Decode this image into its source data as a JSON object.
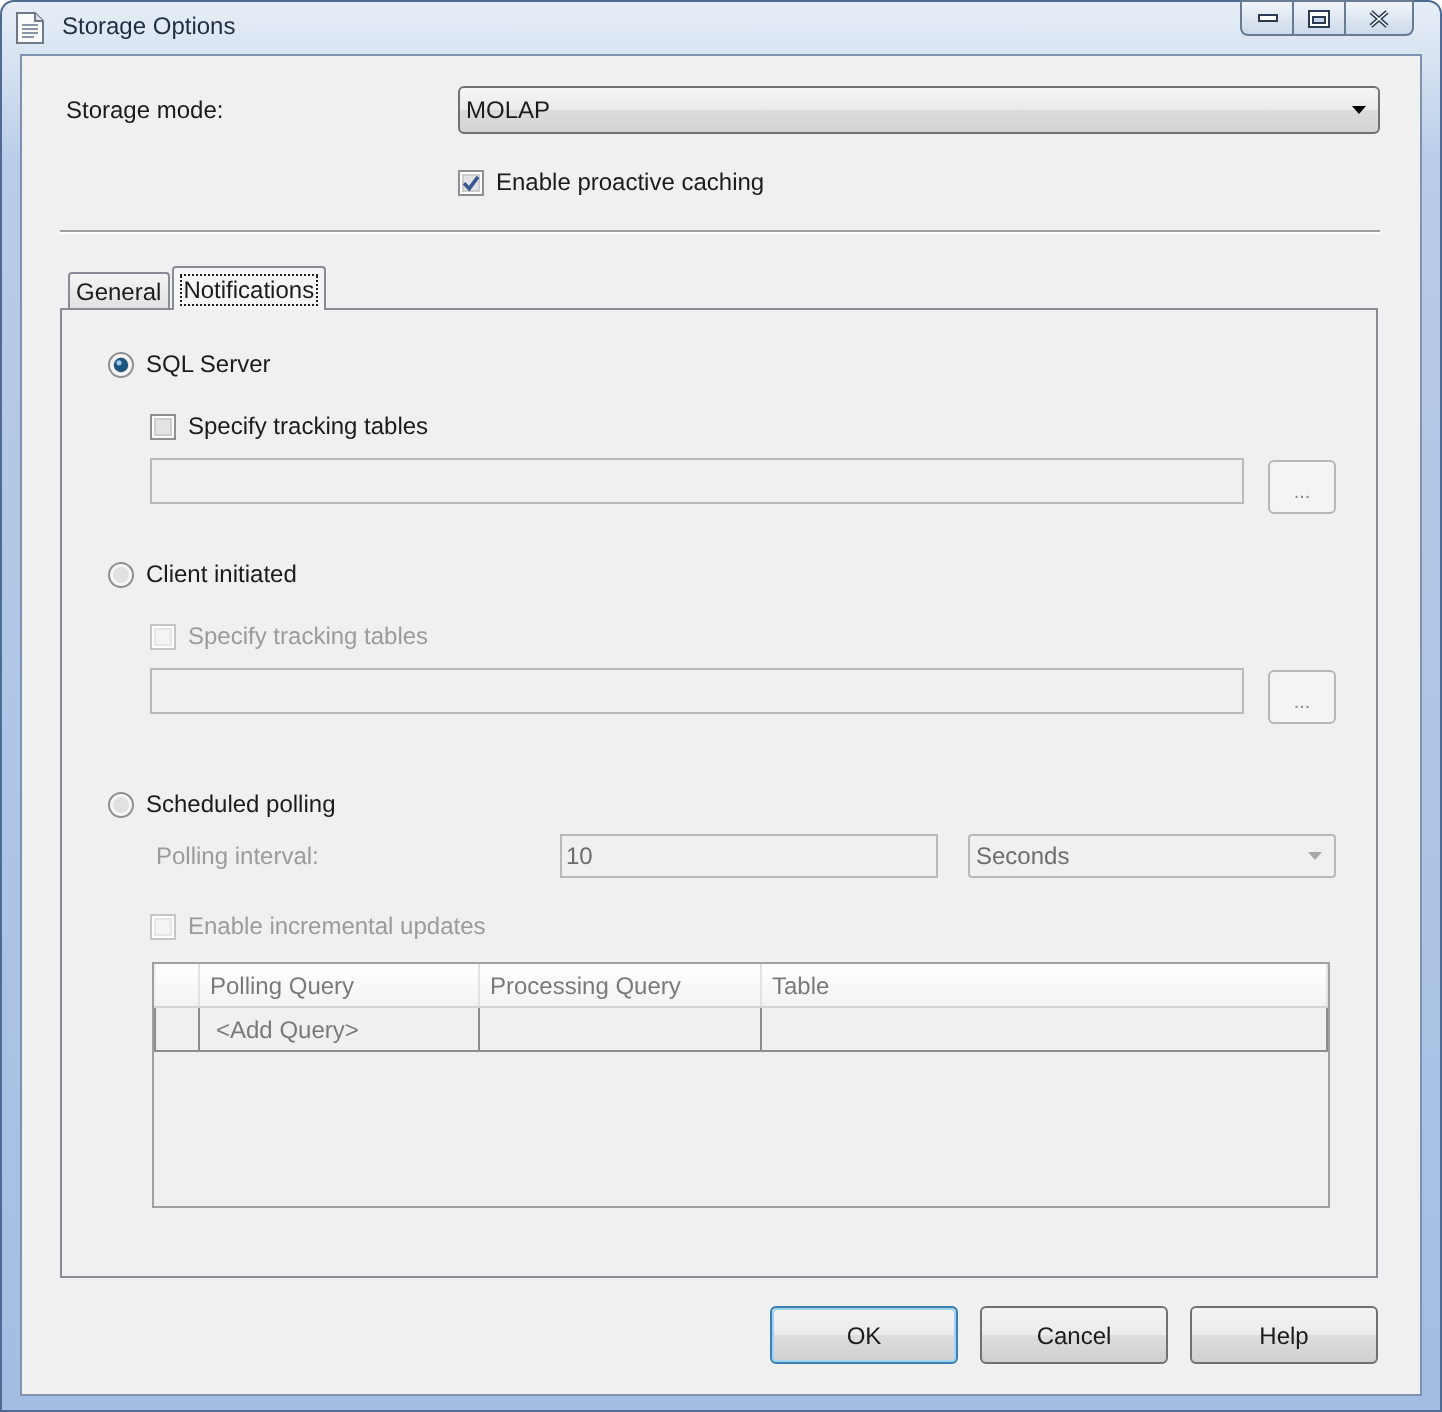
{
  "window": {
    "title": "Storage Options"
  },
  "storage_mode": {
    "label": "Storage mode:",
    "value": "MOLAP"
  },
  "proactive_caching": {
    "label": "Enable proactive caching",
    "checked": true
  },
  "tabs": [
    {
      "label": "General",
      "selected": false
    },
    {
      "label": "Notifications",
      "selected": true
    }
  ],
  "notification_sources": [
    {
      "kind": "tracking",
      "label": "SQL Server",
      "selected": true,
      "tracking_tables": {
        "label": "Specify tracking tables",
        "checked": false,
        "disabled": false
      },
      "tables_field": {
        "disabled": true
      },
      "browse_button": {
        "label": "...",
        "disabled": true
      }
    },
    {
      "kind": "tracking",
      "label": "Client initiated",
      "selected": false,
      "tracking_tables": {
        "label": "Specify tracking tables",
        "checked": false,
        "disabled": true
      },
      "tables_field": {
        "disabled": true
      },
      "browse_button": {
        "label": "...",
        "disabled": true
      }
    },
    {
      "kind": "polling",
      "label": "Scheduled polling",
      "selected": false,
      "polling_interval": {
        "label": "Polling interval:",
        "value": "10",
        "unit": "Seconds",
        "disabled": true
      },
      "incremental_updates": {
        "label": "Enable incremental updates",
        "checked": false,
        "disabled": true
      },
      "query_grid": {
        "columns": [
          "Polling Query",
          "Processing Query",
          "Table"
        ],
        "rows": [
          {
            "cells": [
              "<Add Query>"
            ]
          }
        ],
        "disabled": true
      }
    }
  ],
  "buttons": [
    {
      "label": "OK",
      "default": true
    },
    {
      "label": "Cancel",
      "default": false
    },
    {
      "label": "Help",
      "default": false
    }
  ]
}
